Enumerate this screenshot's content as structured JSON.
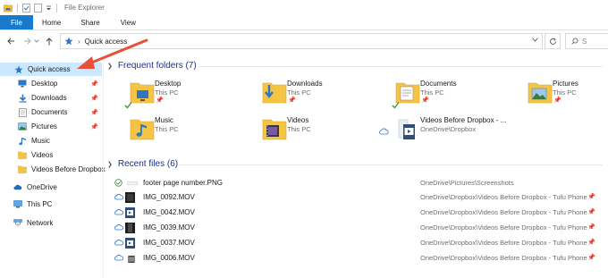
{
  "window": {
    "title": "File Explorer",
    "tabs": [
      "File",
      "Home",
      "Share",
      "View"
    ]
  },
  "address": {
    "breadcrumb": "Quick access",
    "search_placeholder": "S"
  },
  "nav": {
    "items": [
      {
        "label": "Quick access",
        "icon": "star-icon",
        "selected": true,
        "pinned": false
      },
      {
        "label": "Desktop",
        "icon": "desktop-icon",
        "pinned": true
      },
      {
        "label": "Downloads",
        "icon": "download-icon",
        "pinned": true
      },
      {
        "label": "Documents",
        "icon": "documents-icon",
        "pinned": true
      },
      {
        "label": "Pictures",
        "icon": "pictures-icon",
        "pinned": true
      },
      {
        "label": "Music",
        "icon": "music-icon",
        "pinned": false
      },
      {
        "label": "Videos",
        "icon": "folder-icon",
        "pinned": false
      },
      {
        "label": "Videos Before Dropbox",
        "icon": "folder-icon",
        "pinned": false
      },
      {
        "label": "OneDrive",
        "icon": "onedrive-icon",
        "pinned": false
      },
      {
        "label": "This PC",
        "icon": "pc-icon",
        "pinned": false
      },
      {
        "label": "Network",
        "icon": "network-icon",
        "pinned": false
      }
    ]
  },
  "frequent": {
    "header": "Frequent folders (7)",
    "folders": [
      {
        "name": "Desktop",
        "location": "This PC",
        "icon": "desktop-folder-icon"
      },
      {
        "name": "Downloads",
        "location": "This PC",
        "icon": "downloads-folder-icon"
      },
      {
        "name": "Documents",
        "location": "This PC",
        "icon": "documents-folder-icon"
      },
      {
        "name": "Pictures",
        "location": "This PC",
        "icon": "pictures-folder-icon"
      },
      {
        "name": "Music",
        "location": "This PC",
        "icon": "music-folder-icon"
      },
      {
        "name": "Videos",
        "location": "This PC",
        "icon": "videos-folder-icon"
      },
      {
        "name": "Videos Before Dropbox - ...",
        "location": "OneDrive\\Dropbox",
        "icon": "video-file-folder-icon"
      }
    ]
  },
  "recent": {
    "header": "Recent files (6)",
    "files": [
      {
        "name": "footer page number.PNG",
        "path": "OneDrive\\Pictures\\Screenshots",
        "status": "synced"
      },
      {
        "name": "IMG_0092.MOV",
        "path": "OneDrive\\Dropbox\\Videos Before Dropbox - Tufu Phone",
        "status": "cloud"
      },
      {
        "name": "IMG_0042.MOV",
        "path": "OneDrive\\Dropbox\\Videos Before Dropbox - Tufu Phone",
        "status": "cloud"
      },
      {
        "name": "IMG_0039.MOV",
        "path": "OneDrive\\Dropbox\\Videos Before Dropbox - Tufu Phone",
        "status": "cloud"
      },
      {
        "name": "IMG_0037.MOV",
        "path": "OneDrive\\Dropbox\\Videos Before Dropbox - Tufu Phone",
        "status": "cloud"
      },
      {
        "name": "IMG_0006.MOV",
        "path": "OneDrive\\Dropbox\\Videos Before Dropbox - Tufu Phone",
        "status": "cloud"
      }
    ]
  },
  "colors": {
    "accent": "#1979ca",
    "selection": "#cce8ff",
    "header_text": "#1e3287",
    "annotation_arrow": "#e8503a",
    "folder_yellow": "#f6c445"
  }
}
